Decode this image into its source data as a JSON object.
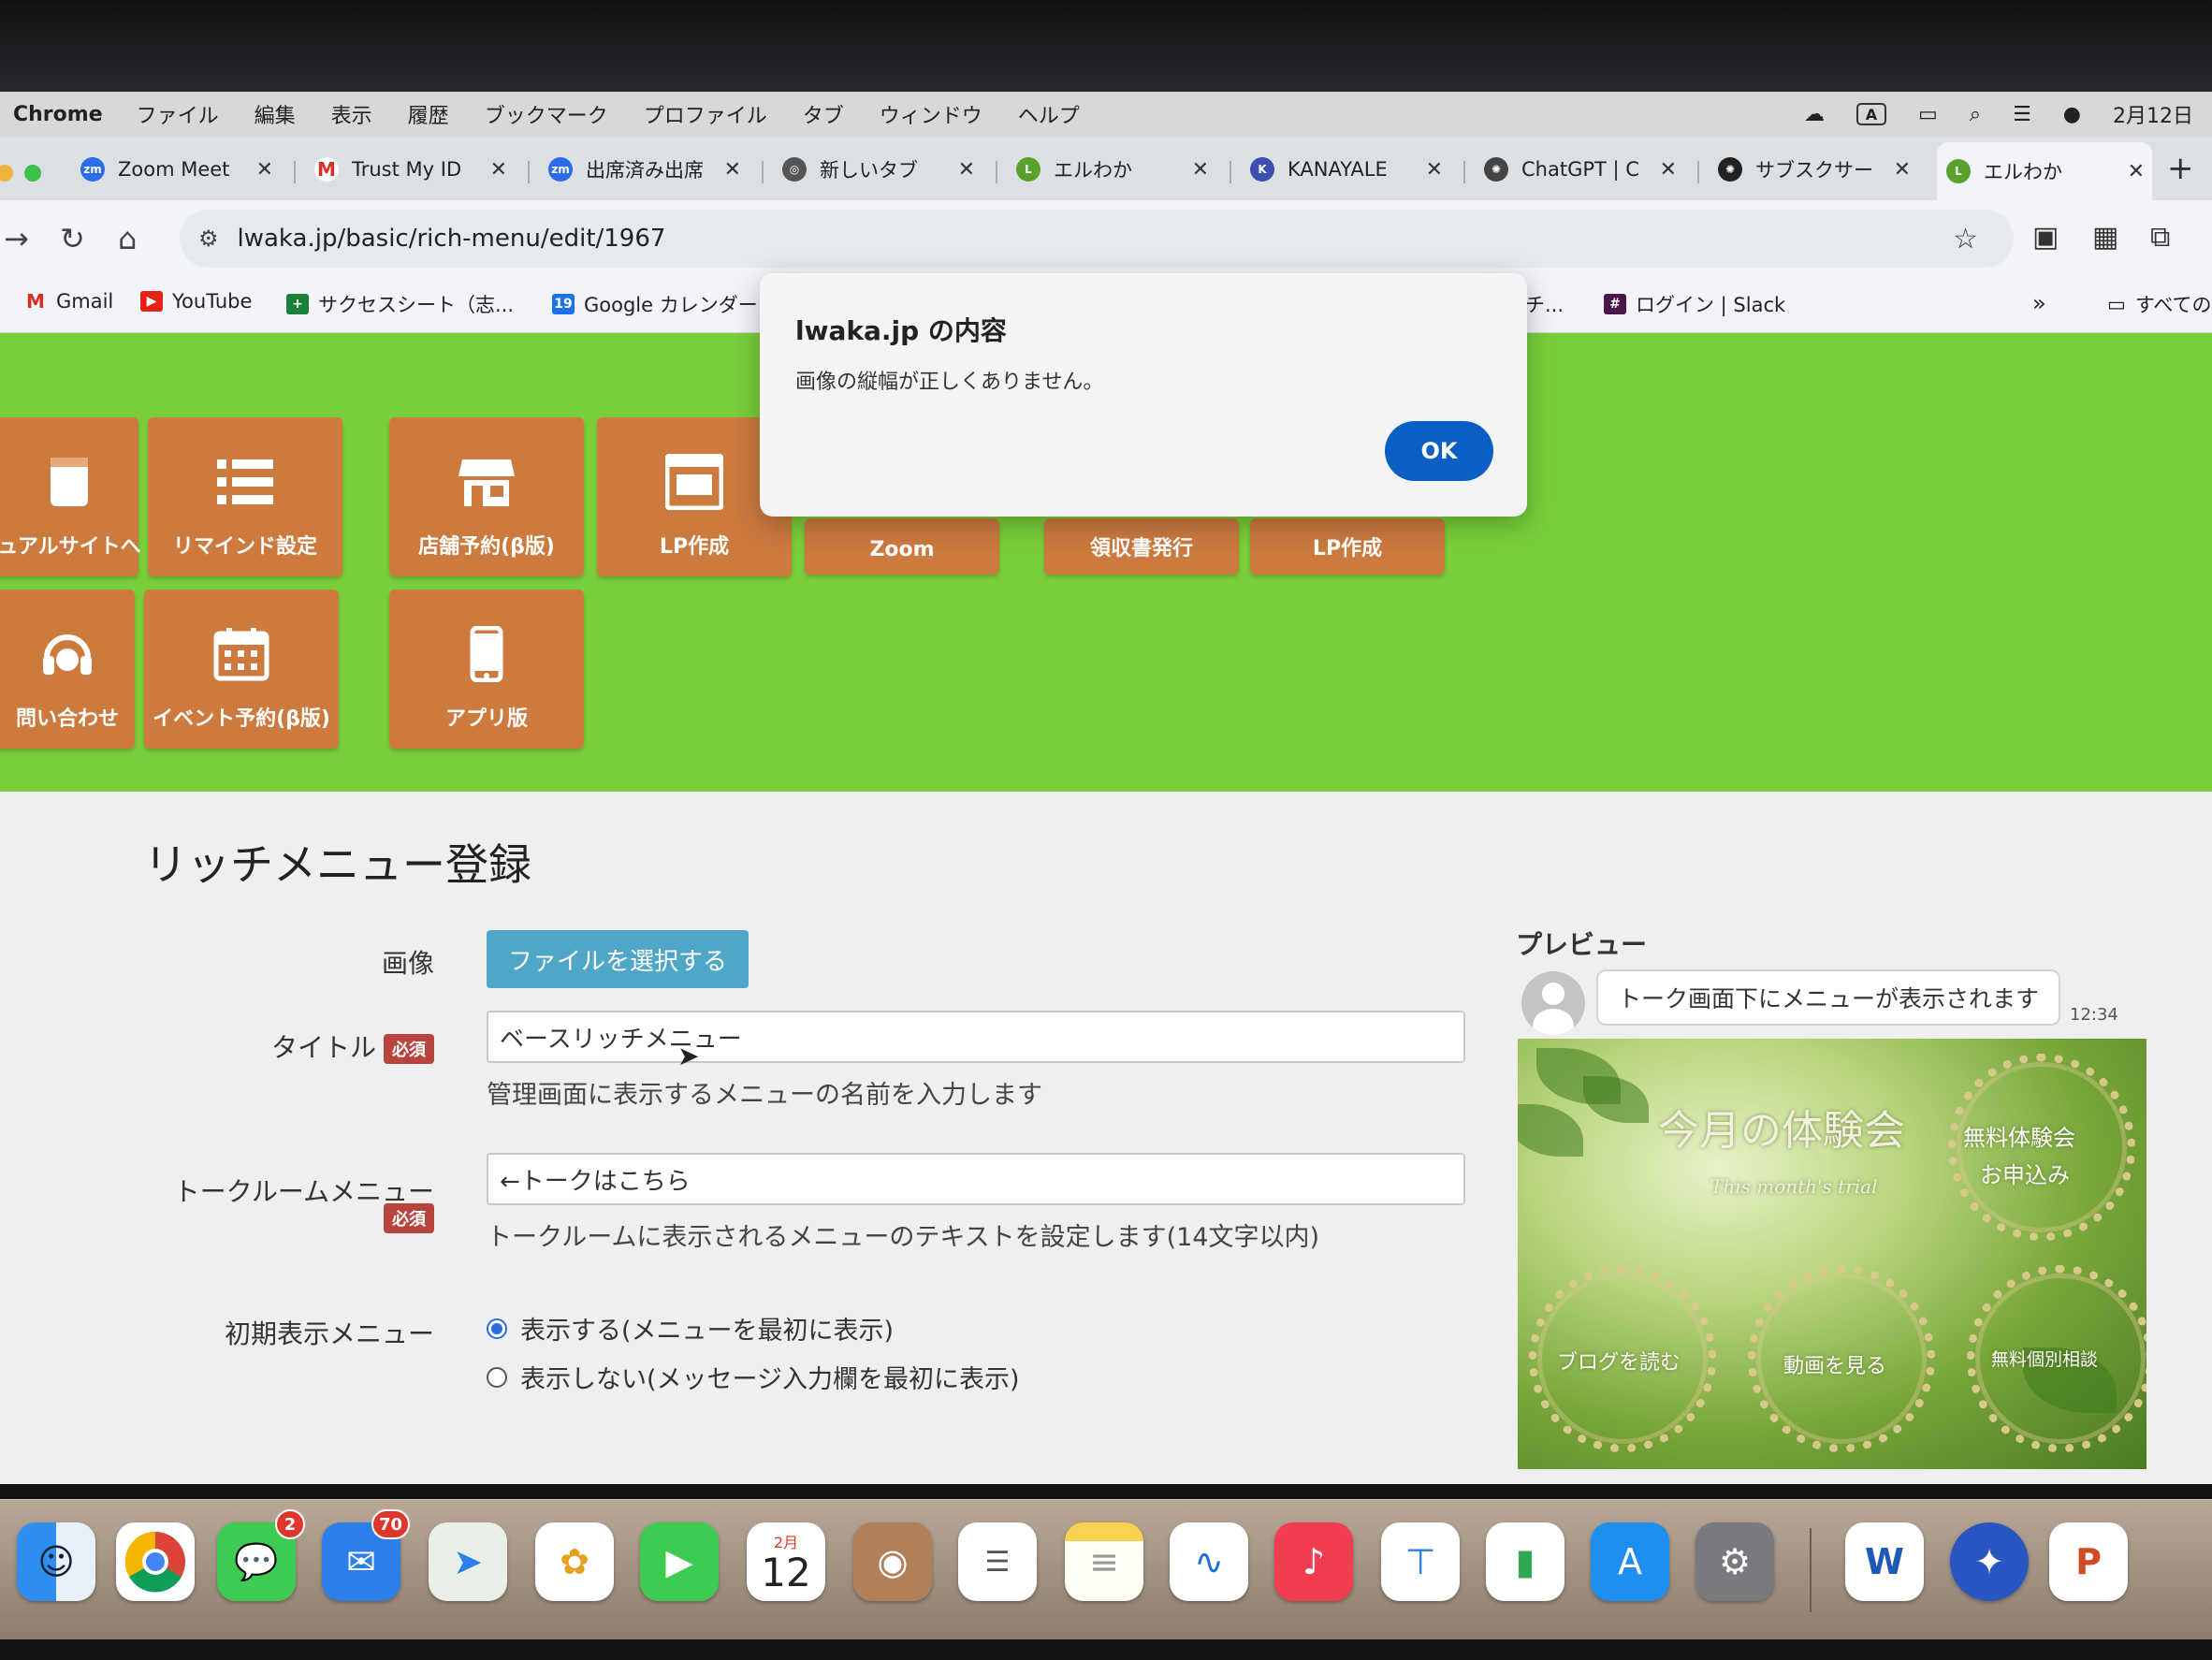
{
  "menubar": {
    "app": "Chrome",
    "items": [
      "ファイル",
      "編集",
      "表示",
      "履歴",
      "ブックマーク",
      "プロファイル",
      "タブ",
      "ウィンドウ",
      "ヘルプ"
    ],
    "date": "2月12日",
    "input_indicator": "A"
  },
  "tabs": [
    {
      "label": "Zoom Meet",
      "favicon": "zoom-icon",
      "color": "#2d6ce8"
    },
    {
      "label": "Trust My ID",
      "favicon": "gmail-icon",
      "color": "#d93025"
    },
    {
      "label": "出席済み出席",
      "favicon": "zoom-icon",
      "color": "#2d6ce8"
    },
    {
      "label": "新しいタブ",
      "favicon": "chrome-icon",
      "color": "#555555"
    },
    {
      "label": "エルわか",
      "favicon": "lwaka-icon",
      "color": "#5aa02c"
    },
    {
      "label": "KANAYALE",
      "favicon": "kanayale-icon",
      "color": "#3a4fb0"
    },
    {
      "label": "ChatGPT | C",
      "favicon": "chatgpt-icon",
      "color": "#444444"
    },
    {
      "label": "サブスクサー",
      "favicon": "chatgpt-icon",
      "color": "#222222"
    },
    {
      "label": "エルわか",
      "favicon": "lwaka-icon",
      "color": "#5aa02c"
    }
  ],
  "address": {
    "url": "lwaka.jp/basic/rich-menu/edit/1967"
  },
  "bookmarks": [
    {
      "label": "Gmail",
      "icon": "gmail-icon",
      "color": "#d93025"
    },
    {
      "label": "YouTube",
      "icon": "youtube-icon",
      "color": "#e62117"
    },
    {
      "label": "サクセスシート（志...",
      "icon": "sheets-icon",
      "color": "#188038"
    },
    {
      "label": "Google カレンダー",
      "icon": "calendar-icon",
      "color": "#1a73e8"
    },
    {
      "label": "チ...",
      "icon": "",
      "color": "#888888"
    },
    {
      "label": "ログイン | Slack",
      "icon": "slack-icon",
      "color": "#4a154b"
    }
  ],
  "bookmarks_more": "»",
  "bookmarks_all": "すべての",
  "tiles": [
    {
      "label": "ュアルサイトへ",
      "icon": "book-icon"
    },
    {
      "label": "リマインド設定",
      "icon": "list-icon"
    },
    {
      "label": "店舗予約(β版)",
      "icon": "store-icon"
    },
    {
      "label": "LP作成",
      "icon": "webpage-icon"
    },
    {
      "label": "Zoom",
      "icon": ""
    },
    {
      "label": "領収書発行",
      "icon": ""
    },
    {
      "label": "LP作成",
      "icon": ""
    },
    {
      "label": "問い合わせ",
      "icon": "headset-icon"
    },
    {
      "label": "イベント予約(β版)",
      "icon": "calendar-icon"
    },
    {
      "label": "アプリ版",
      "icon": "phone-icon"
    }
  ],
  "form": {
    "page_title": "リッチメニュー登録",
    "image_label": "画像",
    "file_button": "ファイルを選択する",
    "title_label": "タイトル",
    "required": "必須",
    "title_value": "ベースリッチメニュー",
    "title_help": "管理画面に表示するメニューの名前を入力します",
    "talkroom_label": "トークルームメニュー",
    "talkroom_value": "←トークはこちら",
    "talkroom_help": "トークルームに表示されるメニューのテキストを設定します(14文字以内)",
    "initial_label": "初期表示メニュー",
    "option_show": "表示する(メニューを最初に表示)",
    "option_hide": "表示しない(メッセージ入力欄を最初に表示)",
    "selected_option": "show"
  },
  "preview": {
    "title": "プレビュー",
    "bubble": "トーク画面下にメニューが表示されます",
    "time": "12:34",
    "image_texts": {
      "headline": "今月の体験会",
      "subline": "This month's trial",
      "circle1_line1": "無料体験会",
      "circle1_line2": "お申込み",
      "circle2": "ブログを読む",
      "circle3": "動画を見る",
      "circle4": "無料個別相談"
    }
  },
  "dialog": {
    "title": "lwaka.jp の内容",
    "message": "画像の縦幅が正しくありません。",
    "ok": "OK"
  },
  "dock": {
    "messages_badge": "2",
    "mail_badge": "70",
    "calendar_month": "2月",
    "calendar_day": "12"
  }
}
